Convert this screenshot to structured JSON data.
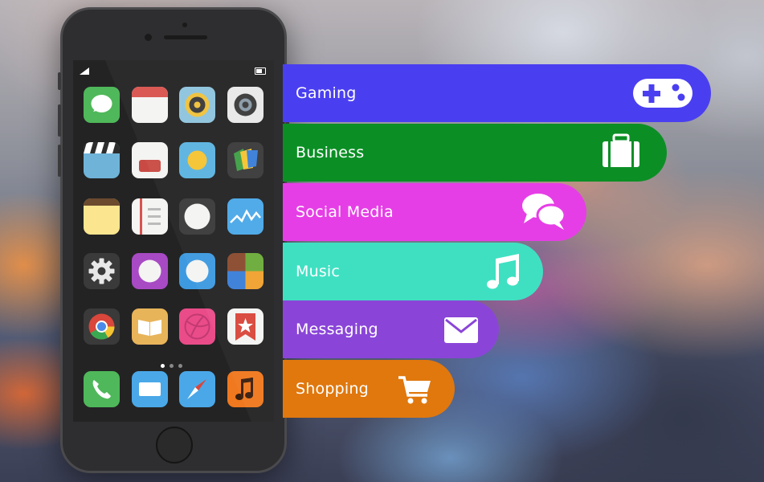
{
  "categories": [
    {
      "label": "Gaming",
      "color": "#4a3ff0",
      "icon": "gamepad-icon"
    },
    {
      "label": "Business",
      "color": "#0b8f25",
      "icon": "briefcase-icon"
    },
    {
      "label": "Social Media",
      "color": "#e63ee6",
      "icon": "chat-bubbles-icon"
    },
    {
      "label": "Music",
      "color": "#3fe0c2",
      "icon": "music-note-icon"
    },
    {
      "label": "Messaging",
      "color": "#8a45d8",
      "icon": "envelope-icon"
    },
    {
      "label": "Shopping",
      "color": "#e0780e",
      "icon": "shopping-cart-icon"
    }
  ],
  "phone": {
    "page_dots": 3,
    "active_page": 1,
    "home_apps": [
      "chat-icon",
      "calendar-icon",
      "camera-icon",
      "lens-icon",
      "clapperboard-icon",
      "wallet-icon",
      "weather-icon",
      "passbook-icon",
      "notes-icon",
      "reminders-icon",
      "clock-icon",
      "stocks-icon",
      "settings-gear-icon",
      "purple-circle-icon",
      "blue-circle-icon",
      "tiles-icon",
      "chrome-icon",
      "book-icon",
      "dribbble-icon",
      "bookmark-star-icon"
    ],
    "dock_apps": [
      "phone-icon",
      "mail-icon",
      "compass-icon",
      "music-app-icon"
    ]
  }
}
